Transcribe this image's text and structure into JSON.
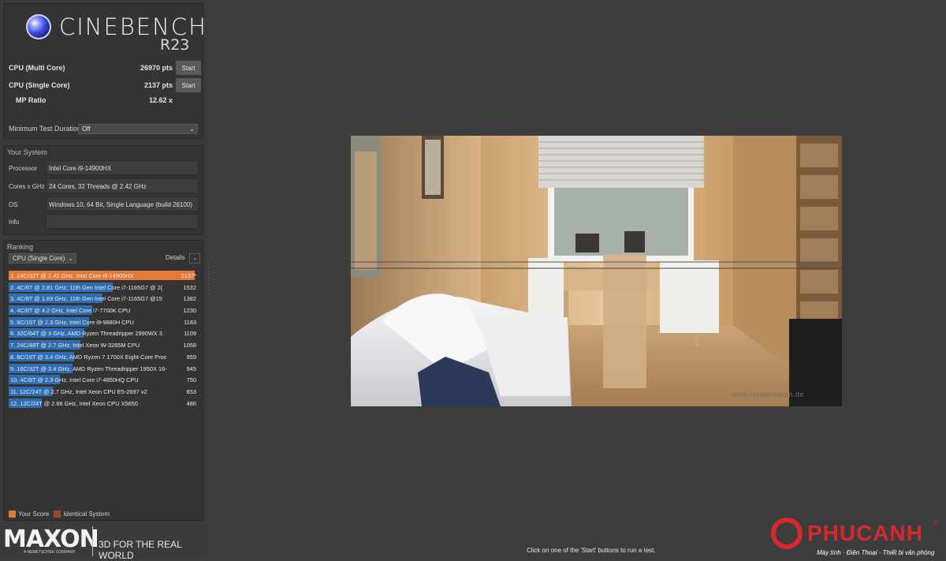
{
  "app": {
    "logo_text": "CINEBENCH",
    "version": "R23"
  },
  "scores": {
    "multi_label": "CPU (Multi Core)",
    "multi_value": "26970 pts",
    "single_label": "CPU (Single Core)",
    "single_value": "2137 pts",
    "mp_label": "MP Ratio",
    "mp_value": "12.62 x",
    "start_label": "Start"
  },
  "min_test": {
    "label": "Minimum Test Duration",
    "value": "Off"
  },
  "system": {
    "title": "Your System",
    "rows": [
      {
        "label": "Processor",
        "value": "Intel Core i9-14900HX"
      },
      {
        "label": "Cores x GHz",
        "value": "24 Cores, 32 Threads @ 2.42 GHz"
      },
      {
        "label": "OS",
        "value": "Windows 10, 64 Bit, Single Language (build 26100)"
      },
      {
        "label": "Info",
        "value": ""
      }
    ]
  },
  "ranking": {
    "title": "Ranking",
    "mode": "CPU (Single Core)",
    "details_label": "Details",
    "max_score": 2137,
    "items": [
      {
        "text": "1. 24C/32T @ 2.42 GHz, Intel Core i9-14900HX",
        "score": "2137*",
        "value": 2137,
        "mine": true
      },
      {
        "text": "2. 4C/8T @ 2.81 GHz, 11th Gen Intel Core i7-1165G7 @ 2(",
        "score": "1532",
        "value": 1532,
        "mine": false
      },
      {
        "text": "3. 4C/8T @ 1.69 GHz, 11th Gen Intel Core i7-1165G7 @15",
        "score": "1382",
        "value": 1382,
        "mine": false
      },
      {
        "text": "4. 4C/8T @ 4.2 GHz, Intel Core i7-7700K CPU",
        "score": "1230",
        "value": 1230,
        "mine": false
      },
      {
        "text": "5. 8C/16T @ 2.3 GHz, Intel Core i9-9880H CPU",
        "score": "1183",
        "value": 1183,
        "mine": false
      },
      {
        "text": "6. 32C/64T @ 3 GHz, AMD Ryzen Threadripper 2990WX 3",
        "score": "1109",
        "value": 1109,
        "mine": false
      },
      {
        "text": "7. 24C/48T @ 2.7 GHz, Intel Xeon W-3265M CPU",
        "score": "1058",
        "value": 1058,
        "mine": false
      },
      {
        "text": "8. 8C/16T @ 3.4 GHz, AMD Ryzen 7 1700X Eight-Core Proc",
        "score": "959",
        "value": 959,
        "mine": false
      },
      {
        "text": "9. 16C/32T @ 3.4 GHz, AMD Ryzen Threadripper 1950X 16-",
        "score": "945",
        "value": 945,
        "mine": false
      },
      {
        "text": "10. 4C/8T @ 2.3 GHz, Intel Core i7-4850HQ CPU",
        "score": "750",
        "value": 750,
        "mine": false
      },
      {
        "text": "11. 12C/24T @ 2.7 GHz, Intel Xeon CPU E5-2697 v2",
        "score": "653",
        "value": 653,
        "mine": false
      },
      {
        "text": "12. 12C/24T @ 2.66 GHz, Intel Xeon CPU X5650",
        "score": "486",
        "value": 486,
        "mine": false
      }
    ],
    "legend_your_score": "Your Score",
    "legend_identical": "Identical System"
  },
  "branding": {
    "maxon": "MAXON",
    "maxon_sub": "A NEMETSCHEK COMPANY",
    "tagline": "3D FOR THE REAL WORLD"
  },
  "render": {
    "caption": "www.renderbaron.de"
  },
  "status": {
    "text": "Click on one of the 'Start' buttons to run a test."
  },
  "watermark": {
    "name": "PHUCANH",
    "sub": "Máy tính · Điện Thoại · Thiết bị văn phòng",
    "reg": "®"
  },
  "colors": {
    "your_score": "#e0793a",
    "identical_system": "#9a4a23",
    "rank_bar": "#2f6db3",
    "background": "#3d3d3d"
  }
}
